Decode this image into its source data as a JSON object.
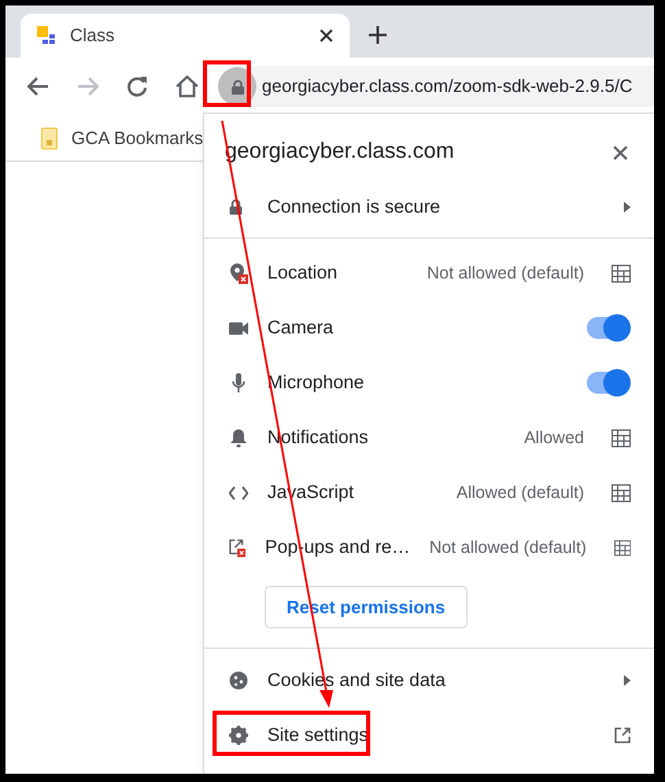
{
  "tab": {
    "title": "Class"
  },
  "address": {
    "url": "georgiacyber.class.com/zoom-sdk-web-2.9.5/C"
  },
  "bookmarks": [
    {
      "label": "GCA Bookmarks"
    }
  ],
  "popup": {
    "site": "georgiacyber.class.com",
    "connection": "Connection is secure",
    "permissions": [
      {
        "label": "Location",
        "kind": "setting",
        "value": "Not allowed (default)"
      },
      {
        "label": "Camera",
        "kind": "toggle",
        "on": true
      },
      {
        "label": "Microphone",
        "kind": "toggle",
        "on": true
      },
      {
        "label": "Notifications",
        "kind": "setting",
        "value": "Allowed"
      },
      {
        "label": "JavaScript",
        "kind": "setting",
        "value": "Allowed (default)"
      },
      {
        "label": "Pop-ups and re…",
        "kind": "setting",
        "value": "Not allowed (default)"
      }
    ],
    "reset_button": "Reset permissions",
    "links": [
      {
        "label": "Cookies and site data",
        "kind": "submenu"
      },
      {
        "label": "Site settings",
        "kind": "external"
      }
    ]
  }
}
